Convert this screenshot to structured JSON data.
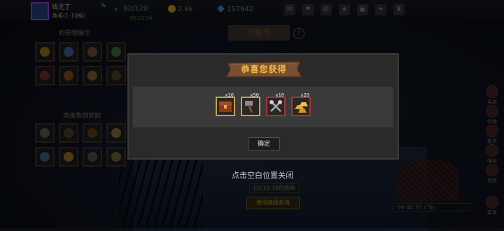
{
  "player": {
    "name": "钱无丁",
    "level_text": "渔者(1-10级)",
    "timer": "00:11:34"
  },
  "stats": {
    "stamina": "92/120",
    "gold": "2.6k",
    "gems": "157942"
  },
  "left_panel": {
    "title1": "钓获物展示",
    "title2": "高级鱼饵奖励"
  },
  "scene": {
    "location_title": "钓鱼场",
    "close_hint": "点击空白位置关闭",
    "countdown": "03:19:38后刷新",
    "use_bait_button": "使用高级鱼饵",
    "right_timer": "09:46:31 / 5h"
  },
  "right_menu": [
    "英雄",
    "领地",
    "集市",
    "强化",
    "竞赛",
    "菜单"
  ],
  "modal": {
    "title": "恭喜您获得",
    "confirm_label": "确定",
    "rewards": [
      {
        "icon": "treasure-chest-icon",
        "count": "x10",
        "rarity": "gold"
      },
      {
        "icon": "hammer-icon",
        "count": "x50",
        "rarity": "gold"
      },
      {
        "icon": "crossed-axes-icon",
        "count": "x10",
        "rarity": "red"
      },
      {
        "icon": "gold-ingots-icon",
        "count": "x20",
        "rarity": "red"
      }
    ]
  },
  "colors": {
    "title_gold": "#f0c040",
    "banner_wood": "#8a5a3a",
    "gold_border": "#c6a24a",
    "red_border": "#a8323c"
  }
}
